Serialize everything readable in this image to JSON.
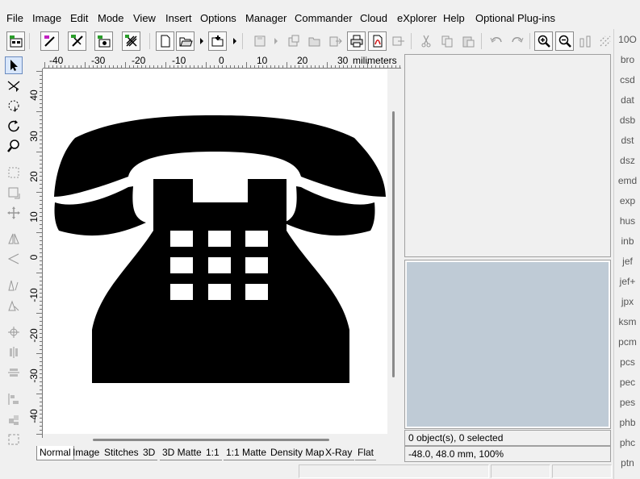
{
  "menu": [
    "File",
    "Image",
    "Edit",
    "Mode",
    "View",
    "Insert",
    "Options",
    "Manager",
    "Commander",
    "Cloud",
    "eXplorer",
    "Help",
    "Optional Plug-ins"
  ],
  "toolbar": {
    "icons": [
      "wizard-icon",
      "magic-wand-icon",
      "auto-digitize-icon",
      "photo-stitch-icon",
      "cross-stitch-icon",
      "new-file-icon",
      "open-folder-icon",
      "open-dropdown-icon",
      "add-file-icon",
      "add-dropdown-icon",
      "save-icon",
      "save-dropdown-icon",
      "save-as-icon",
      "folder-icon",
      "export-icon",
      "print-icon",
      "pdf-icon",
      "convert-icon",
      "cut-icon",
      "copy-icon",
      "paste-icon",
      "undo-icon",
      "redo-icon",
      "zoom-in-icon",
      "zoom-out-icon",
      "measure-icon",
      "stitch-icon"
    ]
  },
  "left_tools": [
    "pointer-icon",
    "lasso-icon",
    "rotate-select-icon",
    "rotate-icon",
    "zoom-tool-icon",
    "rect-select-icon",
    "resize-icon",
    "move-icon",
    "mirror-h-icon",
    "mirror-v-icon",
    "skew-h-icon",
    "skew-v-icon",
    "center-icon",
    "align-h-icon",
    "align-v-icon",
    "distribute-icon",
    "arrange-icon",
    "crop-icon"
  ],
  "ruler": {
    "unit": "milimeters",
    "top_labels": [
      "-40",
      "-30",
      "-20",
      "-10",
      "0",
      "10",
      "20",
      "30"
    ],
    "left_labels": [
      "40",
      "30",
      "20",
      "10",
      "0",
      "-10",
      "-20",
      "-30",
      "-40"
    ]
  },
  "view_tabs": [
    "Normal",
    "Image",
    "Stitches",
    "3D",
    "3D Matte",
    "1:1",
    "1:1 Matte",
    "Density Map",
    "X-Ray",
    "Flat"
  ],
  "active_tab": "Normal",
  "status": {
    "selection": "0 object(s), 0 selected",
    "coordinates": "-48.0, 48.0 mm, 100%"
  },
  "formats": [
    "10O",
    "bro",
    "csd",
    "dat",
    "dsb",
    "dst",
    "dsz",
    "emd",
    "exp",
    "hus",
    "inb",
    "jef",
    "jef+",
    "jpx",
    "ksm",
    "pcm",
    "pcs",
    "pec",
    "pes",
    "phb",
    "phc",
    "ptn"
  ],
  "colors": {
    "preview_bg": "#bfcbd6",
    "design": "#000000",
    "canvas": "#ffffff"
  }
}
